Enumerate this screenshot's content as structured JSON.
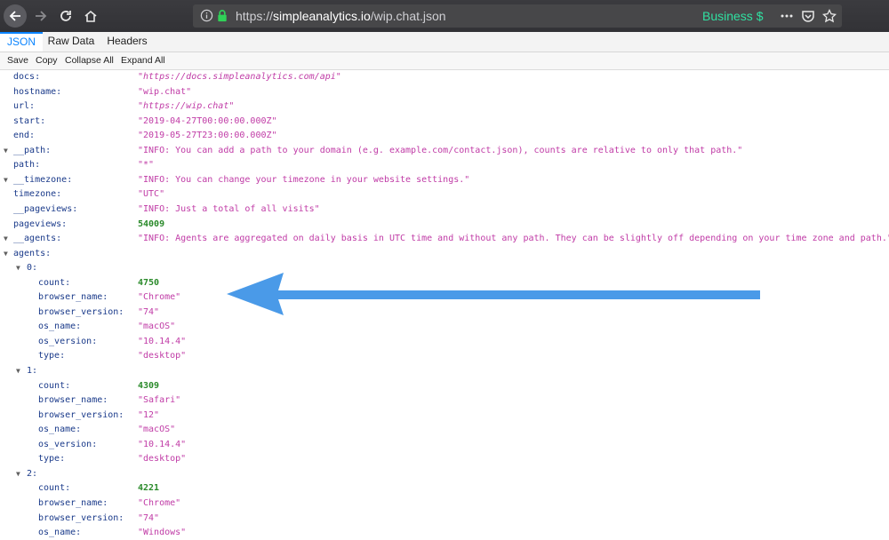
{
  "browser": {
    "url_prefix": "https://",
    "url_host": "simpleanalytics.io",
    "url_path": "/wip.chat.json",
    "business_label": "Business",
    "business_symbol": "$"
  },
  "tabs": [
    "JSON",
    "Raw Data",
    "Headers"
  ],
  "actions": [
    "Save",
    "Copy",
    "Collapse All",
    "Expand All"
  ],
  "rows": [
    {
      "key": "docs:",
      "value": "\"https://docs.simpleanalytics.com/api\"",
      "kind": "url",
      "indent": 0,
      "twisty": false
    },
    {
      "key": "hostname:",
      "value": "\"wip.chat\"",
      "kind": "string",
      "indent": 0,
      "twisty": false
    },
    {
      "key": "url:",
      "value": "\"https://wip.chat\"",
      "kind": "url",
      "indent": 0,
      "twisty": false
    },
    {
      "key": "start:",
      "value": "\"2019-04-27T00:00:00.000Z\"",
      "kind": "string",
      "indent": 0,
      "twisty": false
    },
    {
      "key": "end:",
      "value": "\"2019-05-27T23:00:00.000Z\"",
      "kind": "string",
      "indent": 0,
      "twisty": false
    },
    {
      "key": "__path:",
      "value": "\"INFO: You can add a path to your domain (e.g. example.com/contact.json), counts are relative to only that path.\"",
      "kind": "string",
      "indent": 0,
      "twisty": true
    },
    {
      "key": "path:",
      "value": "\"*\"",
      "kind": "string",
      "indent": 0,
      "twisty": false
    },
    {
      "key": "__timezone:",
      "value": "\"INFO: You can change your timezone in your website settings.\"",
      "kind": "string",
      "indent": 0,
      "twisty": true
    },
    {
      "key": "timezone:",
      "value": "\"UTC\"",
      "kind": "string",
      "indent": 0,
      "twisty": false
    },
    {
      "key": "__pageviews:",
      "value": "\"INFO: Just a total of all visits\"",
      "kind": "string",
      "indent": 0,
      "twisty": false
    },
    {
      "key": "pageviews:",
      "value": "54009",
      "kind": "number",
      "indent": 0,
      "twisty": false
    },
    {
      "key": "__agents:",
      "value": "\"INFO: Agents are aggregated on daily basis in UTC time and without any path. They can be slightly off depending on your time zone and path.\"",
      "kind": "string",
      "indent": 0,
      "twisty": true
    },
    {
      "key": "agents:",
      "value": "",
      "kind": "none",
      "indent": 0,
      "twisty": true
    },
    {
      "key": "0:",
      "value": "",
      "kind": "none",
      "indent": 1,
      "twisty": true
    },
    {
      "key": "count:",
      "value": "4750",
      "kind": "number",
      "indent": 2,
      "twisty": false
    },
    {
      "key": "browser_name:",
      "value": "\"Chrome\"",
      "kind": "string",
      "indent": 2,
      "twisty": false
    },
    {
      "key": "browser_version:",
      "value": "\"74\"",
      "kind": "string",
      "indent": 2,
      "twisty": false
    },
    {
      "key": "os_name:",
      "value": "\"macOS\"",
      "kind": "string",
      "indent": 2,
      "twisty": false
    },
    {
      "key": "os_version:",
      "value": "\"10.14.4\"",
      "kind": "string",
      "indent": 2,
      "twisty": false
    },
    {
      "key": "type:",
      "value": "\"desktop\"",
      "kind": "string",
      "indent": 2,
      "twisty": false
    },
    {
      "key": "1:",
      "value": "",
      "kind": "none",
      "indent": 1,
      "twisty": true
    },
    {
      "key": "count:",
      "value": "4309",
      "kind": "number",
      "indent": 2,
      "twisty": false
    },
    {
      "key": "browser_name:",
      "value": "\"Safari\"",
      "kind": "string",
      "indent": 2,
      "twisty": false
    },
    {
      "key": "browser_version:",
      "value": "\"12\"",
      "kind": "string",
      "indent": 2,
      "twisty": false
    },
    {
      "key": "os_name:",
      "value": "\"macOS\"",
      "kind": "string",
      "indent": 2,
      "twisty": false
    },
    {
      "key": "os_version:",
      "value": "\"10.14.4\"",
      "kind": "string",
      "indent": 2,
      "twisty": false
    },
    {
      "key": "type:",
      "value": "\"desktop\"",
      "kind": "string",
      "indent": 2,
      "twisty": false
    },
    {
      "key": "2:",
      "value": "",
      "kind": "none",
      "indent": 1,
      "twisty": true
    },
    {
      "key": "count:",
      "value": "4221",
      "kind": "number",
      "indent": 2,
      "twisty": false
    },
    {
      "key": "browser_name:",
      "value": "\"Chrome\"",
      "kind": "string",
      "indent": 2,
      "twisty": false
    },
    {
      "key": "browser_version:",
      "value": "\"74\"",
      "kind": "string",
      "indent": 2,
      "twisty": false
    },
    {
      "key": "os_name:",
      "value": "\"Windows\"",
      "kind": "string",
      "indent": 2,
      "twisty": false
    }
  ],
  "colors": {
    "key": "#1a3a8a",
    "string": "#c03ba6",
    "number": "#2a8a2a",
    "accent": "#0a84ff",
    "arrow": "#4a9ae8"
  }
}
